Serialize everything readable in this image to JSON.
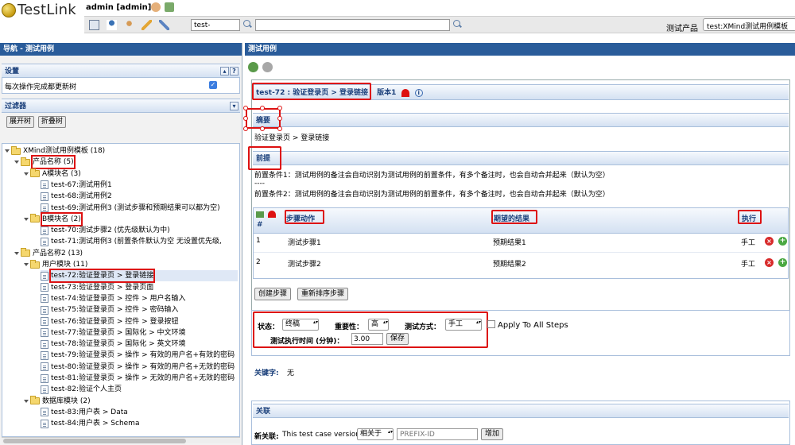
{
  "header": {
    "logo_text": "TestLink",
    "user": "admin [admin]",
    "search_prefix": "test-",
    "search_value": "",
    "product_label": "测试产品",
    "product_selected": "test:XMind测试用例模板"
  },
  "left": {
    "nav_title": "导航 - 测试用例",
    "settings_title": "设置",
    "settings_help": "?",
    "refresh_label": "每次操作完成都更新树",
    "refresh_checked": true,
    "filter_title": "过滤器",
    "expand_btn": "展开树",
    "collapse_btn": "折叠树",
    "tree": [
      {
        "label": "XMind测试用例模板 (18)",
        "type": "folder",
        "level": 0
      },
      {
        "label": "产品名称 (5)",
        "type": "folder",
        "level": 1,
        "highlight": true
      },
      {
        "label": "A模块名 (3)",
        "type": "folder",
        "level": 2
      },
      {
        "label": "test-67:测试用例1",
        "type": "doc",
        "level": 3
      },
      {
        "label": "test-68:测试用例2",
        "type": "doc",
        "level": 3
      },
      {
        "label": "test-69:测试用例3 (测试步骤和预期结果可以都为空)",
        "type": "doc",
        "level": 3
      },
      {
        "label": "B模块名 (2)",
        "type": "folder",
        "level": 2,
        "highlight": true
      },
      {
        "label": "test-70:测试步骤2 (优先级默认为中)",
        "type": "doc",
        "level": 3
      },
      {
        "label": "test-71:测试用例3 (前置条件默认为空  无设置优先级,",
        "type": "doc",
        "level": 3
      },
      {
        "label": "产品名称2 (13)",
        "type": "folder",
        "level": 1
      },
      {
        "label": "用户模块 (11)",
        "type": "folder",
        "level": 2
      },
      {
        "label": "test-72:验证登录页 > 登录链接",
        "type": "doc",
        "level": 3,
        "highlight": true,
        "selected": true
      },
      {
        "label": "test-73:验证登录页 > 登录页面",
        "type": "doc",
        "level": 3
      },
      {
        "label": "test-74:验证登录页 > 控件 > 用户名输入",
        "type": "doc",
        "level": 3
      },
      {
        "label": "test-75:验证登录页 > 控件 > 密码输入",
        "type": "doc",
        "level": 3
      },
      {
        "label": "test-76:验证登录页 > 控件 > 登录按钮",
        "type": "doc",
        "level": 3
      },
      {
        "label": "test-77:验证登录页 > 国际化 > 中文环境",
        "type": "doc",
        "level": 3
      },
      {
        "label": "test-78:验证登录页 > 国际化 > 英文环境",
        "type": "doc",
        "level": 3
      },
      {
        "label": "test-79:验证登录页 > 操作 > 有效的用户名+有效的密码",
        "type": "doc",
        "level": 3
      },
      {
        "label": "test-80:验证登录页 > 操作 > 有效的用户名+无效的密码",
        "type": "doc",
        "level": 3
      },
      {
        "label": "test-81:验证登录页 > 操作 > 无效的用户名+无效的密码",
        "type": "doc",
        "level": 3
      },
      {
        "label": "test-82:验证个人主页",
        "type": "doc",
        "level": 3
      },
      {
        "label": "数据库模块 (2)",
        "type": "folder",
        "level": 2
      },
      {
        "label": "test-83:用户表 > Data",
        "type": "doc",
        "level": 3
      },
      {
        "label": "test-84:用户表 > Schema",
        "type": "doc",
        "level": 3
      }
    ]
  },
  "right": {
    "title": "测试用例",
    "case_title": "test-72 : 验证登录页 > 登录链接",
    "version": "版本1",
    "summary_label": "摘要",
    "summary_text": "验证登录页 > 登录链接",
    "precondition_label": "前提",
    "precondition_1": "前置条件1：测试用例的备注会自动识别为测试用例的前置条件，有多个备注时，也会自动合并起来（默认为空）",
    "separator": "----",
    "precondition_2": "前置条件2：测试用例的备注会自动识别为测试用例的前置条件，有多个备注时，也会自动合并起来（默认为空）",
    "steps_header": {
      "num": "#",
      "action": "步骤动作",
      "expected": "期望的结果",
      "exec": "执行"
    },
    "steps": [
      {
        "num": "1",
        "action": "测试步骤1",
        "expected": "预期结果1",
        "exec": "手工"
      },
      {
        "num": "2",
        "action": "测试步骤2",
        "expected": "预期结果2",
        "exec": "手工"
      }
    ],
    "create_step_btn": "创建步骤",
    "reorder_step_btn": "重新排序步骤",
    "status_label": "状态：",
    "status_value": "终稿",
    "importance_label": "重要性：",
    "importance_value": "高",
    "exec_type_label": "测试方式：",
    "exec_type_value": "手工",
    "apply_all_label": "Apply To All Steps",
    "duration_label": "测试执行时间 (分钟)：",
    "duration_value": "3.00",
    "save_btn": "保存",
    "keywords_label": "关键字:",
    "keywords_value": "无",
    "relations_label": "关联",
    "new_relation_label": "新关联:",
    "new_relation_text": "This test case version",
    "relation_type": "相关于",
    "relation_placeholder": "PREFIX-ID",
    "add_btn": "增加"
  }
}
